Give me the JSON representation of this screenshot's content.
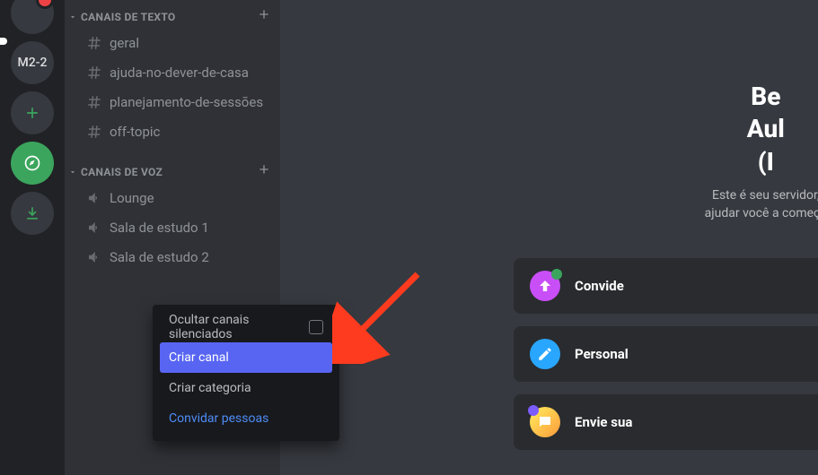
{
  "rail": {
    "server_label": "M2-2"
  },
  "categories": [
    {
      "name": "CANAIS DE TEXTO",
      "channels": [
        {
          "name": "geral"
        },
        {
          "name": "ajuda-no-dever-de-casa"
        },
        {
          "name": "planejamento-de-sessões"
        },
        {
          "name": "off-topic"
        }
      ]
    },
    {
      "name": "CANAIS DE VOZ",
      "channels": [
        {
          "name": "Lounge"
        },
        {
          "name": "Sala de estudo 1"
        },
        {
          "name": "Sala de estudo 2"
        }
      ]
    }
  ],
  "welcome": {
    "title_line1": "Be",
    "title_line2": "Aul",
    "title_line3": "(I",
    "desc_line1": "Este é seu servidor,",
    "desc_line2": "ajudar você a começa"
  },
  "cards": [
    {
      "title": "Convide"
    },
    {
      "title": "Personal"
    },
    {
      "title": "Envie sua"
    }
  ],
  "context_menu": {
    "mute": "Ocultar canais silenciados",
    "create_channel": "Criar canal",
    "create_category": "Criar categoria",
    "invite": "Convidar pessoas"
  }
}
